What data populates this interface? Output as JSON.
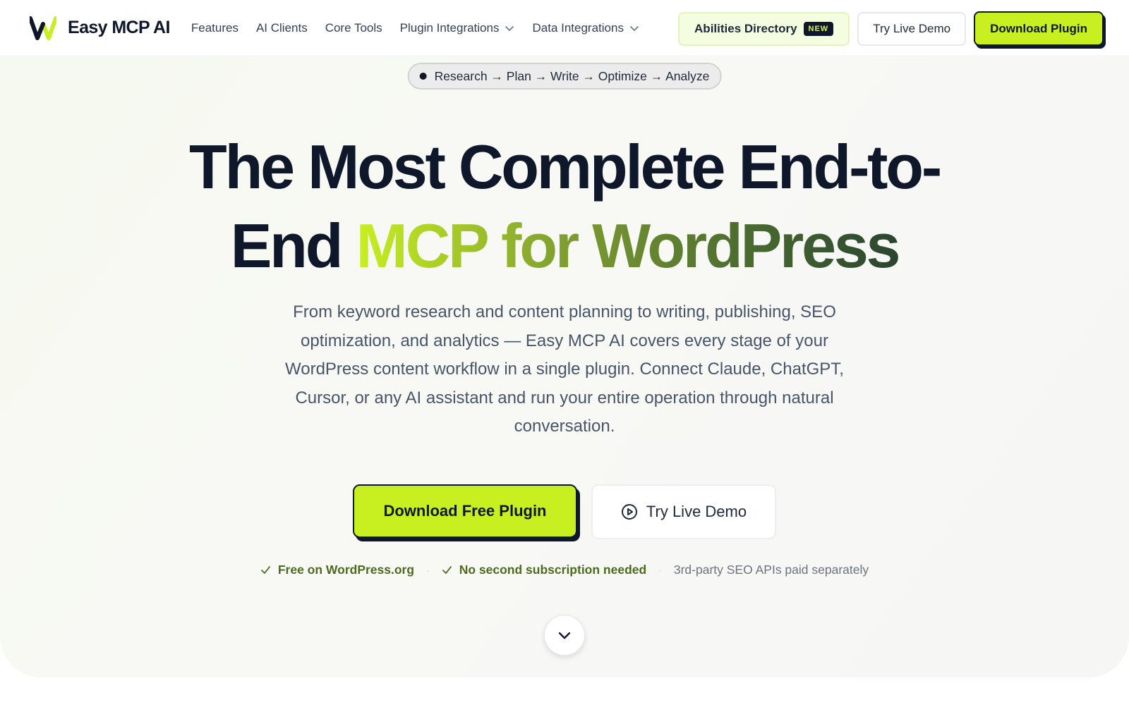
{
  "brand": {
    "name": "Easy MCP AI",
    "logo_icon": "easy-mcp-w-logo"
  },
  "nav": {
    "items": [
      {
        "label": "Features",
        "dropdown": false
      },
      {
        "label": "AI Clients",
        "dropdown": false
      },
      {
        "label": "Core Tools",
        "dropdown": false
      },
      {
        "label": "Plugin Integrations",
        "dropdown": true
      },
      {
        "label": "Data Integrations",
        "dropdown": true
      }
    ],
    "abilities_label": "Abilities Directory",
    "new_badge": "NEW",
    "try_demo_label": "Try Live Demo",
    "download_label": "Download Plugin"
  },
  "hero": {
    "pill_text": "Research → Plan → Write → Optimize → Analyze",
    "headline_line1": "The Most Complete End-to-",
    "headline_line2_plain": "End ",
    "headline_line2_accent": "MCP for WordPress",
    "subtext": "From keyword research and content planning to writing, publishing, SEO optimization, and analytics — Easy MCP AI covers every stage of your WordPress content workflow in a single plugin. Connect Claude, ChatGPT, Cursor, or any AI assistant and run your entire operation through natural conversation.",
    "cta_primary": "Download Free Plugin",
    "cta_secondary": "Try Live Demo",
    "trust": {
      "item1": "Free on WordPress.org",
      "item2": "No second subscription needed",
      "item3": "3rd-party SEO APIs paid separately"
    }
  },
  "colors": {
    "accent_lime": "#c8f020",
    "dark": "#0f172a",
    "trust_green": "#4d6b1d",
    "gradient_end": "#2a4530"
  }
}
